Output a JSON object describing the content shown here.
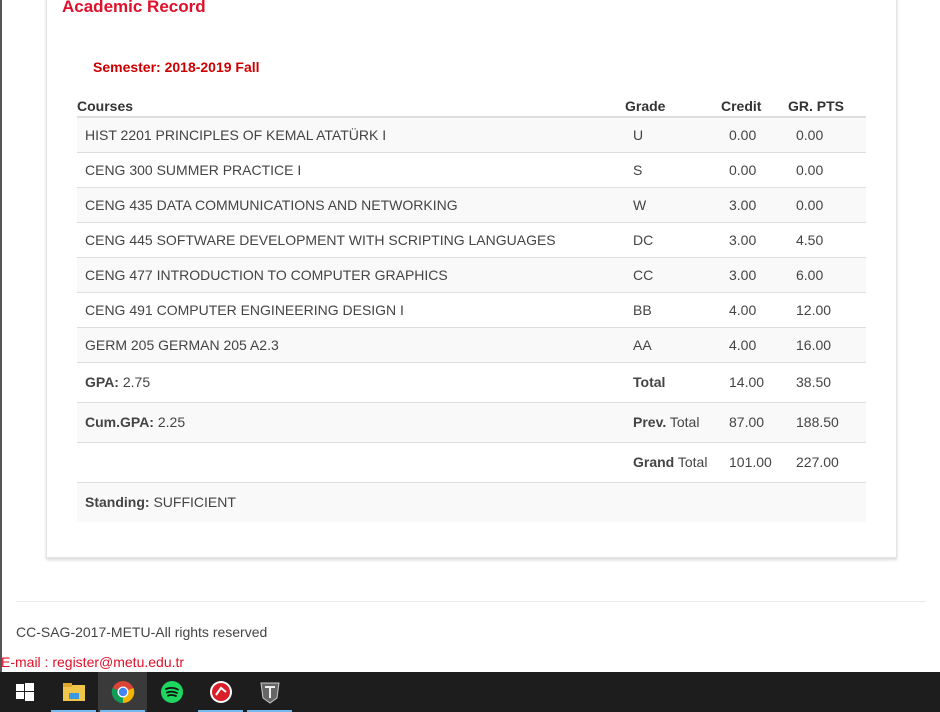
{
  "page": {
    "title": "Academic Record",
    "semester": "Semester: 2018-2019 Fall"
  },
  "table": {
    "headers": [
      "Courses",
      "Grade",
      "Credit",
      "GR. PTS"
    ],
    "rows": [
      {
        "course": "HIST 2201 PRINCIPLES OF KEMAL ATATÜRK I",
        "grade": "U",
        "credit": "0.00",
        "pts": "0.00"
      },
      {
        "course": "CENG 300 SUMMER PRACTICE I",
        "grade": "S",
        "credit": "0.00",
        "pts": "0.00"
      },
      {
        "course": "CENG 435 DATA COMMUNICATIONS AND NETWORKING",
        "grade": "W",
        "credit": "3.00",
        "pts": "0.00"
      },
      {
        "course": "CENG 445 SOFTWARE DEVELOPMENT WITH SCRIPTING LANGUAGES",
        "grade": "DC",
        "credit": "3.00",
        "pts": "4.50"
      },
      {
        "course": "CENG 477 INTRODUCTION TO COMPUTER GRAPHICS",
        "grade": "CC",
        "credit": "3.00",
        "pts": "6.00"
      },
      {
        "course": "CENG 491 COMPUTER ENGINEERING DESIGN I",
        "grade": "BB",
        "credit": "4.00",
        "pts": "12.00"
      },
      {
        "course": "GERM 205 GERMAN 205 A2.3",
        "grade": "AA",
        "credit": "4.00",
        "pts": "16.00"
      }
    ]
  },
  "summary": {
    "gpa_label": "GPA:",
    "gpa": "2.75",
    "total_label": "Total",
    "total_credit": "14.00",
    "total_pts": "38.50",
    "cumgpa_label": "Cum.GPA:",
    "cumgpa": "2.25",
    "prev_bold": "Prev.",
    "prev_rest": "Total",
    "prev_credit": "87.00",
    "prev_pts": "188.50",
    "grand_bold": "Grand",
    "grand_rest": "Total",
    "grand_credit": "101.00",
    "grand_pts": "227.00",
    "standing_label": "Standing:",
    "standing": "SUFFICIENT"
  },
  "footer": {
    "copyright": "CC-SAG-2017-METU-All rights reserved",
    "email": "E-mail : register@metu.edu.tr"
  },
  "taskbar": {
    "icons": [
      "windows-start",
      "file-explorer",
      "chrome",
      "spotify",
      "wargaming",
      "world-of-tanks"
    ]
  }
}
